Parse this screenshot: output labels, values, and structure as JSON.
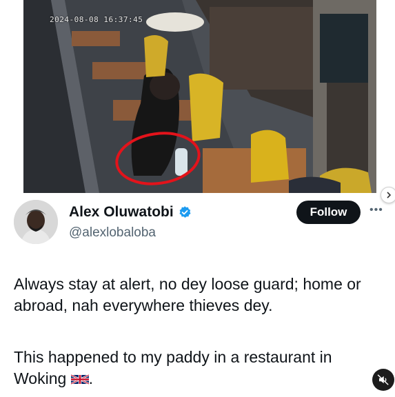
{
  "media": {
    "cctv_timestamp": "2024-08-‍08 16:37:45",
    "description_icon": "cctv-photo"
  },
  "author": {
    "display_name": "Alex Oluwatobi",
    "handle": "@alexlobaloba",
    "verified": true
  },
  "actions": {
    "follow_label": "Follow",
    "more_icon": "•••"
  },
  "tweet": {
    "paragraph1": "Always stay at alert, no dey loose guard; home or abroad, nah everywhere thieves dey.",
    "paragraph2_text": "This happened to my paddy in a restaurant in Woking",
    "paragraph2_end": "."
  },
  "colors": {
    "accent": "#1d9bf0",
    "text": "#0f1419",
    "secondary": "#536471",
    "annotation": "#e3131b"
  }
}
